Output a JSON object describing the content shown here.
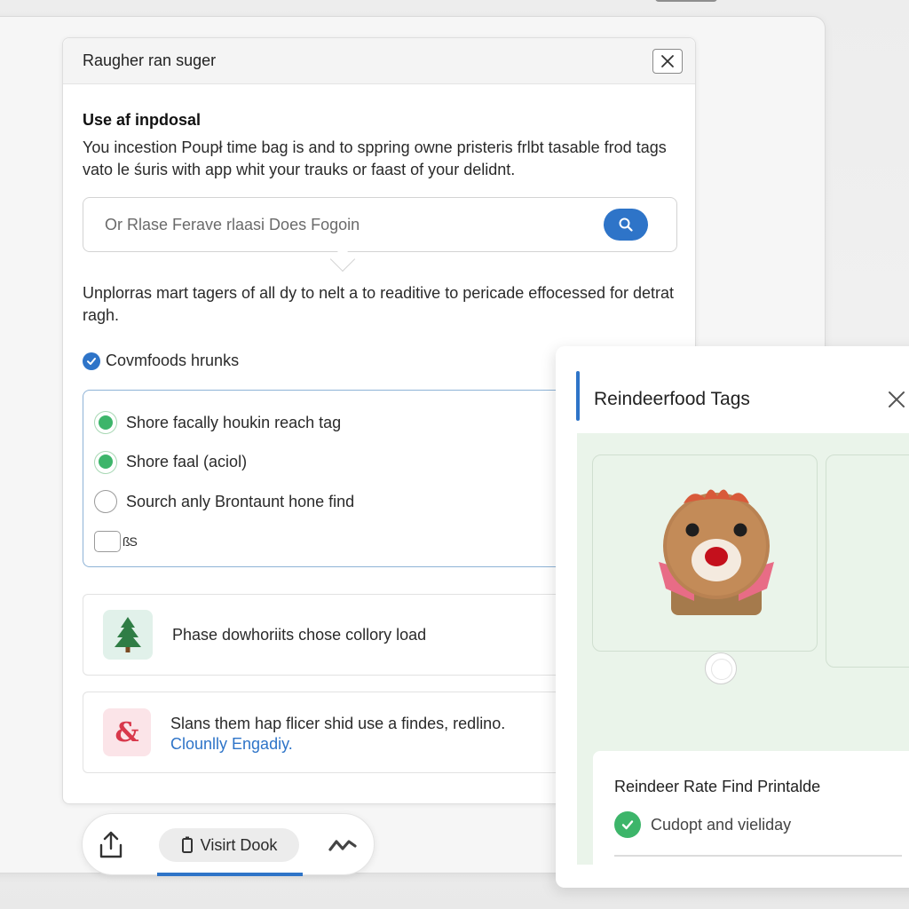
{
  "dialog": {
    "title": "Raugher ran suger",
    "section_heading": "Use af inpdosal",
    "description": "You incestion Poupł time bag is and to sppring owne pristeris frlbt tasable frod tags vato le śuris with app whit your trauks or faast of your delidnt.",
    "search": {
      "placeholder": "Or Rlase Ferave rlaasi Does Fogoin"
    },
    "paragraph": "Unplorras mart tagers of all dy to nelt a to readitive to pericade effocessed for detrat ragh.",
    "checkbox_label": "Covmfoods hrunks",
    "options": [
      {
        "label": "Shore facally houkin reach tag",
        "state": "selected"
      },
      {
        "label": "Shore faal (aciol)",
        "state": "selected"
      },
      {
        "label": "Sourch anly Brontaunt hone find",
        "state": "unselected"
      },
      {
        "label": "ßS",
        "state": "checkbox-unchecked"
      }
    ],
    "cards": [
      {
        "icon": "tree-icon",
        "text": "Phase dowhoriits chose collory load"
      },
      {
        "icon": "ampersand-icon",
        "text": "Slans them hap flicer shid use a findes, redlino.",
        "link": "Clounlly Engadiy."
      }
    ]
  },
  "bottom_bar": {
    "share_icon": "share-icon",
    "visit_label": "Visirt Dook",
    "more_icon": "chevron-wave-icon",
    "accent_color": "#2e74c8"
  },
  "panel": {
    "title": "Reindeerfood Tags",
    "tiles": [
      {
        "image": "reindeer-icon"
      },
      {
        "image": "empty"
      }
    ],
    "result": {
      "title": "Reindeer Rate Find Printalde",
      "status": "Cudopt and vieliday",
      "status_color": "#3db56a"
    }
  },
  "colors": {
    "accent": "#2e74c8",
    "success": "#3db56a",
    "panel_background": "#eaf4ea"
  }
}
